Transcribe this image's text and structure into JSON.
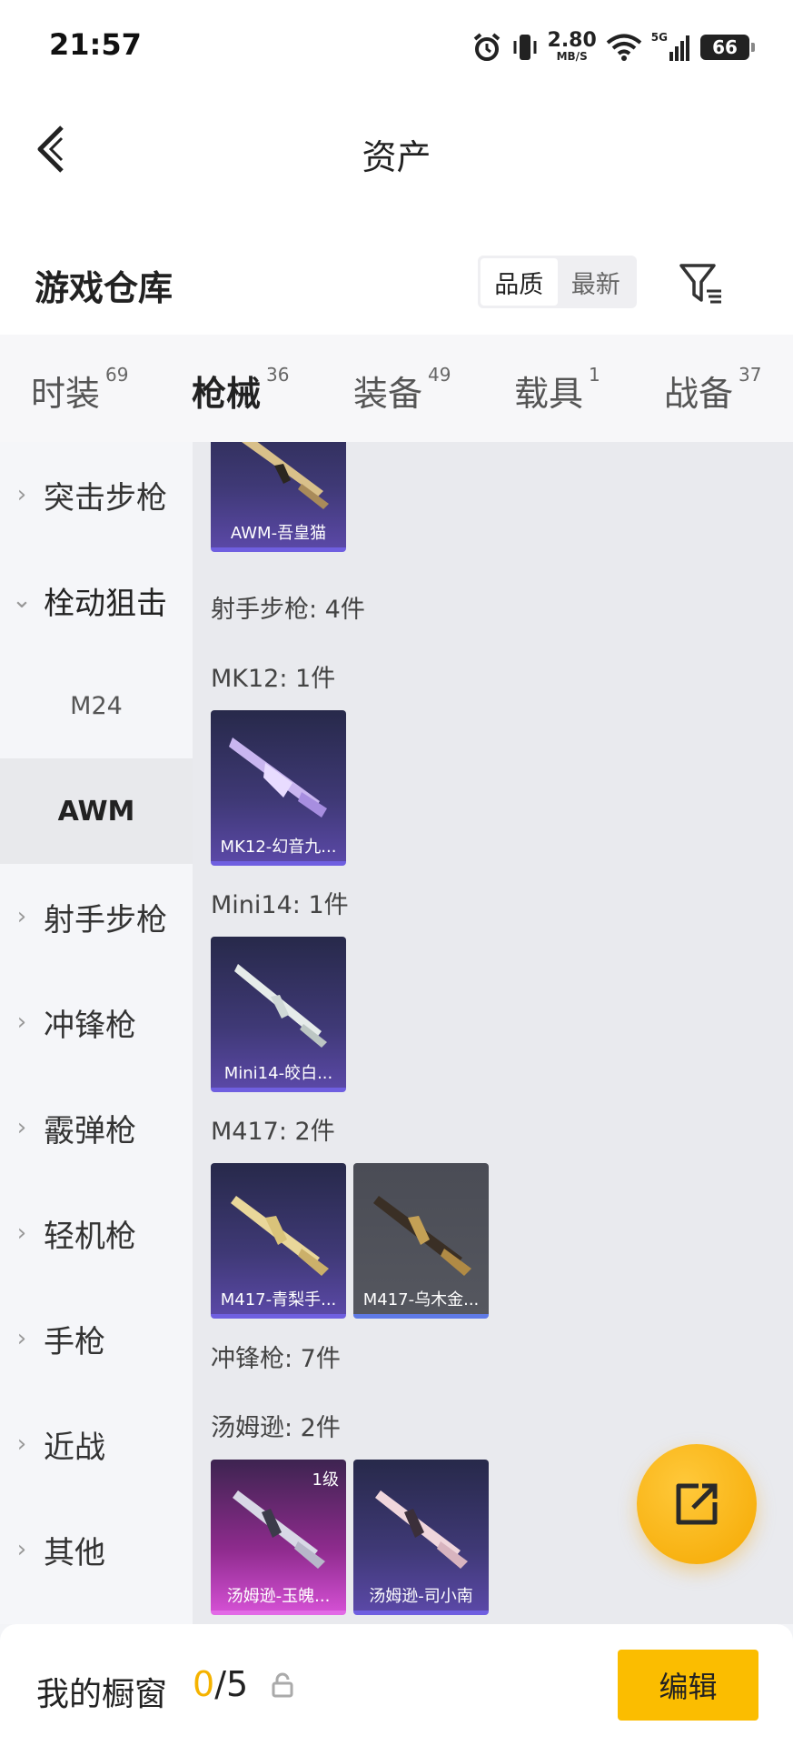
{
  "status_bar": {
    "time": "21:57",
    "net_speed_value": "2.80",
    "net_speed_unit": "MB/S",
    "network": "5G",
    "battery": "66"
  },
  "header": {
    "title": "资产"
  },
  "warehouse": {
    "title": "游戏仓库",
    "sort_options": [
      "品质",
      "最新"
    ],
    "active_sort": "品质"
  },
  "tabs": [
    {
      "label": "时装",
      "count": "69"
    },
    {
      "label": "枪械",
      "count": "36",
      "active": true
    },
    {
      "label": "装备",
      "count": "49"
    },
    {
      "label": "载具",
      "count": "1"
    },
    {
      "label": "战备",
      "count": "37"
    }
  ],
  "sidenav": {
    "items": [
      {
        "label": "突击步枪"
      },
      {
        "label": "栓动狙击",
        "expanded": true
      },
      {
        "label": "M24",
        "sub": true
      },
      {
        "label": "AWM",
        "sub": true,
        "selected": true
      },
      {
        "label": "射手步枪"
      },
      {
        "label": "冲锋枪"
      },
      {
        "label": "霰弹枪"
      },
      {
        "label": "轻机枪"
      },
      {
        "label": "手枪"
      },
      {
        "label": "近战"
      },
      {
        "label": "其他"
      }
    ]
  },
  "content": {
    "card_awm": "AWM-吾皇猫",
    "section_marksman": "射手步枪: 4件",
    "group_mk12": "MK12: 1件",
    "card_mk12": "MK12-幻音九...",
    "group_mini14": "Mini14: 1件",
    "card_mini14": "Mini14-皎白...",
    "group_m417": "M417: 2件",
    "card_m417_1": "M417-青梨手...",
    "card_m417_2": "M417-乌木金...",
    "section_smg": "冲锋枪: 7件",
    "group_tommy": "汤姆逊: 2件",
    "card_tommy_1": "汤姆逊-玉魄...",
    "card_tommy_1_level": "1级",
    "card_tommy_2": "汤姆逊-司小南"
  },
  "bottom_bar": {
    "title": "我的橱窗",
    "current": "0",
    "total": "/5",
    "edit_label": "编辑"
  },
  "colors": {
    "accent": "#f6b800",
    "card_purple": "#3f3976",
    "card_pink": "#d24fd2"
  }
}
